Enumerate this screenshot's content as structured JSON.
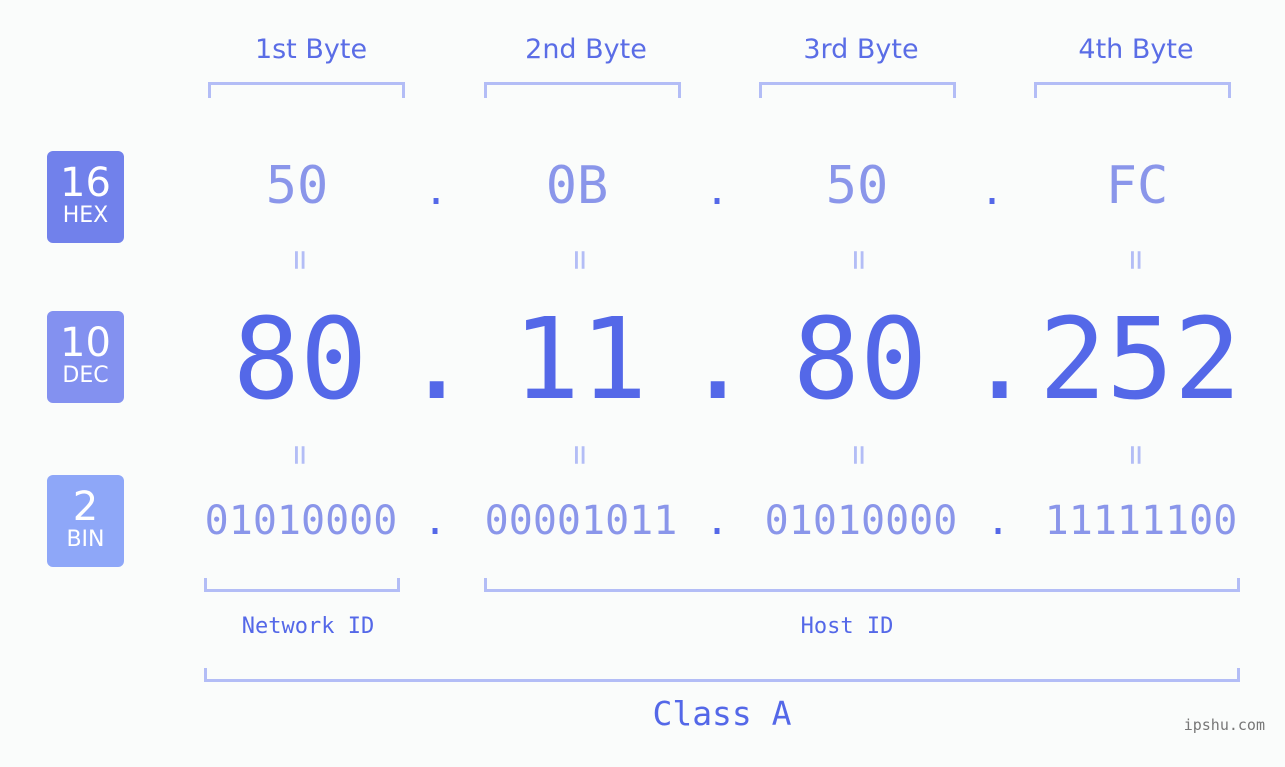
{
  "byte_headers": [
    "1st Byte",
    "2nd Byte",
    "3rd Byte",
    "4th Byte"
  ],
  "badges": [
    {
      "number": "16",
      "label": "HEX",
      "color": "#7181eb"
    },
    {
      "number": "10",
      "label": "DEC",
      "color": "#8391f0"
    },
    {
      "number": "2",
      "label": "BIN",
      "color": "#8ea7f8"
    }
  ],
  "hex": [
    "50",
    "0B",
    "50",
    "FC"
  ],
  "dec": [
    "80",
    "11",
    "80",
    "252"
  ],
  "bin": [
    "01010000",
    "00001011",
    "01010000",
    "11111100"
  ],
  "separator": ".",
  "equals": "=",
  "network_label": "Network ID",
  "host_label": "Host ID",
  "class_label": "Class A",
  "watermark": "ipshu.com",
  "colors": {
    "accent": "#5468e8",
    "light": "#8a96ea",
    "bracket": "#b3bdf6"
  }
}
